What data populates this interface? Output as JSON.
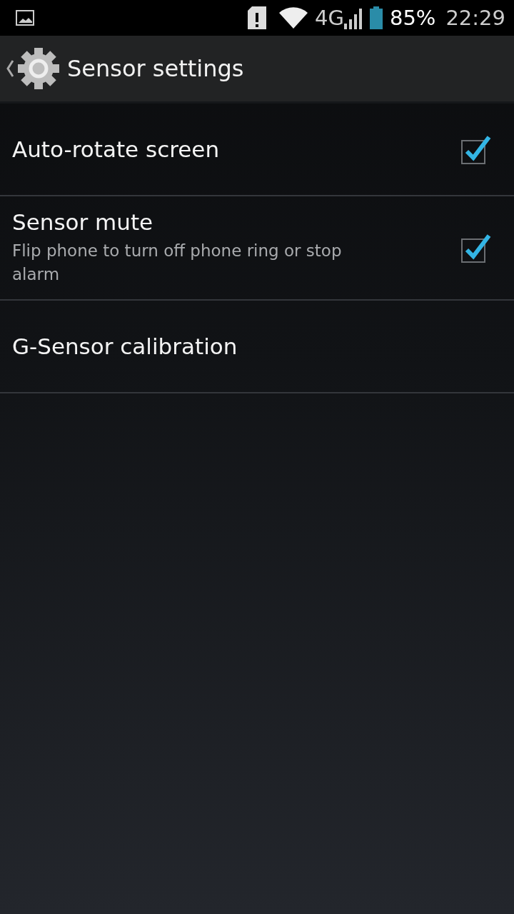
{
  "status_bar": {
    "network": "4G",
    "battery": "85%",
    "time": "22:29"
  },
  "header": {
    "title": "Sensor settings"
  },
  "items": [
    {
      "kind": "checkbox",
      "title": "Auto-rotate screen",
      "checked": true
    },
    {
      "kind": "checkbox",
      "title": "Sensor mute",
      "summary": "Flip phone to turn off phone ring or stop alarm",
      "checked": true
    },
    {
      "kind": "action",
      "title": "G-Sensor calibration"
    }
  ]
}
